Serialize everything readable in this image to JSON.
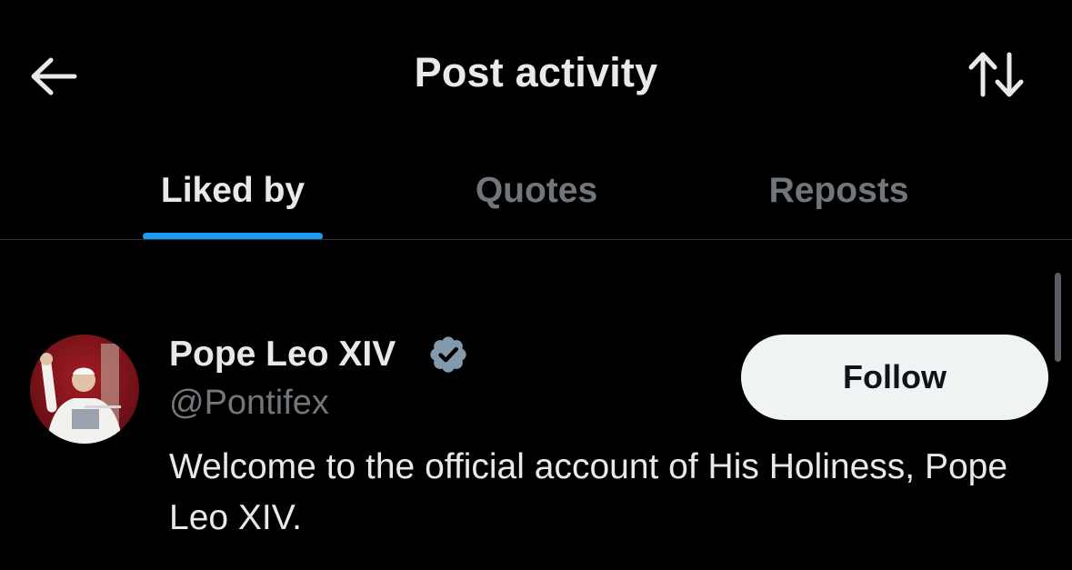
{
  "header": {
    "title": "Post activity",
    "back_icon": "arrow-left-icon",
    "sort_icon": "sort-arrows-icon"
  },
  "tabs": [
    {
      "label": "Liked by",
      "active": true
    },
    {
      "label": "Quotes",
      "active": false
    },
    {
      "label": "Reposts",
      "active": false
    }
  ],
  "colors": {
    "accent": "#1d9bf0",
    "background": "#000000",
    "text_primary": "#e7e9ea",
    "text_secondary": "#71767b",
    "follow_bg": "#eff3f4",
    "verified_badge": "#829aab"
  },
  "users": [
    {
      "name": "Pope Leo XIV",
      "handle": "@Pontifex",
      "verified": true,
      "verified_icon": "verified-badge-icon",
      "bio": "Welcome to the official account of His Holiness, Pope Leo XIV.",
      "follow_label": "Follow"
    }
  ]
}
